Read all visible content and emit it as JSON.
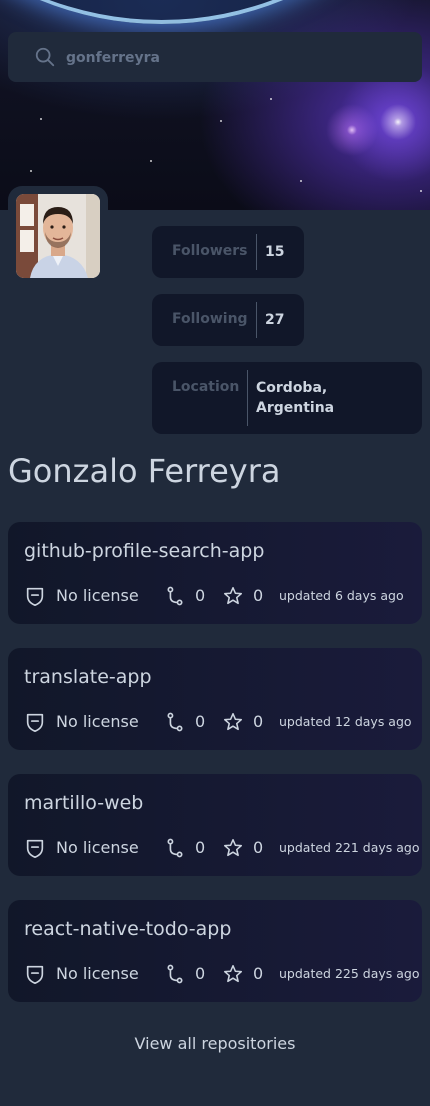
{
  "search": {
    "value": "gonferreyra",
    "placeholder": "username"
  },
  "profile": {
    "name": "Gonzalo Ferreyra",
    "followers_label": "Followers",
    "followers_count": "15",
    "following_label": "Following",
    "following_count": "27",
    "location_label": "Location",
    "location_value": "Cordoba, Argentina"
  },
  "repos": [
    {
      "name": "github-profile-search-app",
      "license": "No license",
      "forks": "0",
      "stars": "0",
      "updated": "updated 6 days ago"
    },
    {
      "name": "translate-app",
      "license": "No license",
      "forks": "0",
      "stars": "0",
      "updated": "updated 12 days ago"
    },
    {
      "name": "martillo-web",
      "license": "No license",
      "forks": "0",
      "stars": "0",
      "updated": "updated 221 days ago"
    },
    {
      "name": "react-native-todo-app",
      "license": "No license",
      "forks": "0",
      "stars": "0",
      "updated": "updated 225 days ago"
    }
  ],
  "view_all_label": "View all repositories",
  "icons": [
    "search-icon",
    "license-shield-icon",
    "fork-icon",
    "star-icon"
  ],
  "colors": {
    "background": "#202a3b",
    "card": "#111729",
    "text": "#cdd5e0",
    "muted": "#4a5568"
  }
}
